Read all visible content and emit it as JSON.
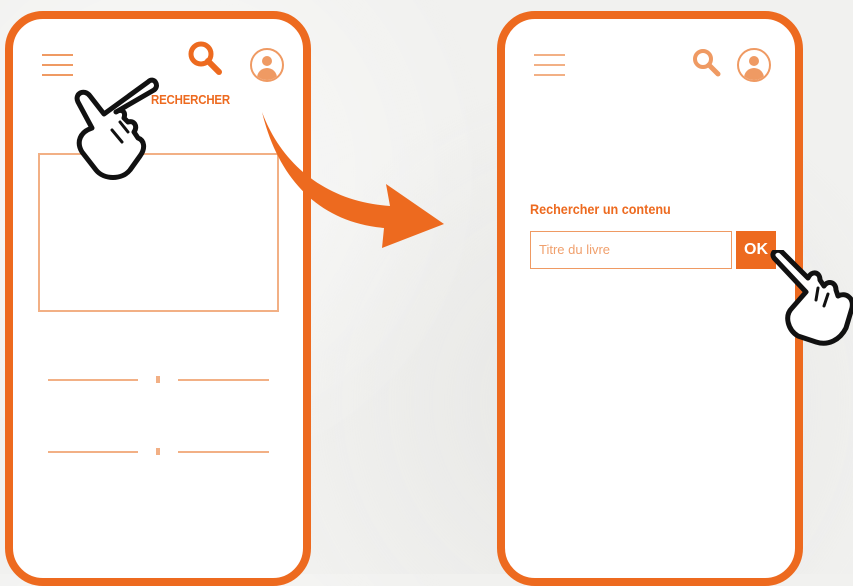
{
  "left_screen": {
    "header": {
      "menu_icon": "hamburger-menu-icon",
      "search_icon": "search-icon",
      "profile_icon": "user-avatar-icon",
      "search_label": "RECHERCHER"
    },
    "pointer_icon": "pointing-hand-icon"
  },
  "transition_icon": "curved-arrow-icon",
  "right_screen": {
    "header": {
      "menu_icon": "hamburger-menu-icon",
      "search_icon": "search-icon",
      "profile_icon": "user-avatar-icon"
    },
    "search_form": {
      "title": "Rechercher un contenu",
      "input_placeholder": "Titre du livre",
      "submit_label": "OK"
    },
    "pointer_icon": "pointing-hand-icon"
  },
  "colors": {
    "accent": "#ed6a1f",
    "light_accent": "#ef9a63",
    "placeholder_stroke": "#f2b085",
    "background": "#f1f1ef"
  }
}
